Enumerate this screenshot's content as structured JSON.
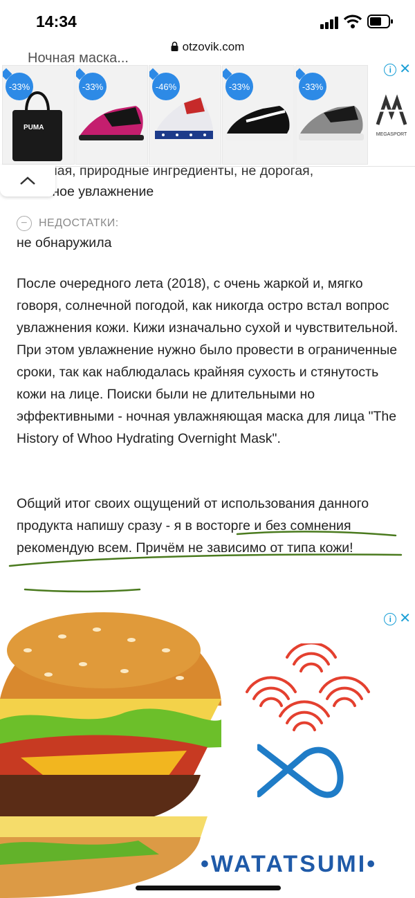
{
  "status": {
    "time": "14:34",
    "url": "otzovik.com"
  },
  "article": {
    "ghost_line": "Ночная маска...",
    "pros_tail_1": "...венная, природные ингредиенты, не дорогая,",
    "pros_tail_2": "отличное увлажнение",
    "cons_label": "НЕДОСТАТКИ:",
    "cons_text": "не обнаружила",
    "paragraph1": "После очередного лета (2018), с очень жаркой и, мягко говоря, солнечной погодой, как никогда остро встал вопрос увлажнения кожи. Кижи изначально сухой и чувствительной. При этом увлажнение нужно было провести в ограниченные сроки, так как наблюдалась крайняя сухость и стянутость кожи на лице. Поиски были не длительными но эффективными - ночная увлажняющая маска для лица \"The History of Whoo Hydrating Overnight Mask\".",
    "paragraph2": "Общий итог своих ощущений от использования данного продукта напишу сразу - я в восторге и без сомнения рекомендую всем. Причём не зависимо от типа кожи!"
  },
  "top_ad": {
    "products": [
      {
        "discount": "-33%",
        "item": "Puma tote bag"
      },
      {
        "discount": "-33%",
        "item": "pink sneaker"
      },
      {
        "discount": "-46%",
        "item": "stars sneaker"
      },
      {
        "discount": "-33%",
        "item": "black Air sneaker"
      },
      {
        "discount": "-33%",
        "item": "grey sneaker"
      }
    ],
    "bag_text": "PUMA",
    "brand": "MEGASPORT",
    "info_icon": "info-icon",
    "close_icon": "close-icon"
  },
  "bottom_ad": {
    "brand": "•WATATSUMI•"
  },
  "colors": {
    "badge": "#2d8ae6",
    "ad_icon": "#1a9fd6",
    "brand_blue": "#1f5aa8",
    "wifi_red": "#e4402f",
    "underline": "#4a7a1e"
  }
}
